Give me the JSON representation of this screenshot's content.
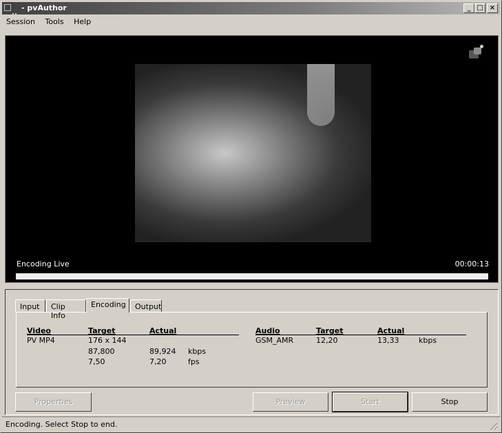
{
  "window": {
    "title": "- pvAuthor",
    "controls": {
      "minimize": "_",
      "maximize": "□",
      "close": "×"
    }
  },
  "menu": [
    "Session",
    "Tools",
    "Help"
  ],
  "video": {
    "status": "Encoding Live",
    "timecode": "00:00:13",
    "progress_percent": 100
  },
  "tabs": [
    {
      "label": "Input",
      "active": false
    },
    {
      "label": "Clip Info",
      "active": false
    },
    {
      "label": "Encoding",
      "active": true
    },
    {
      "label": "Output",
      "active": false
    }
  ],
  "encoding": {
    "video": {
      "headers": [
        "Video",
        "Target",
        "Actual"
      ],
      "codec": "PV MP4",
      "rows": [
        {
          "target": "176 x 144",
          "actual": "",
          "unit": ""
        },
        {
          "target": "87,800",
          "actual": "89,924",
          "unit": "kbps"
        },
        {
          "target": "7,50",
          "actual": "7,20",
          "unit": "fps"
        }
      ]
    },
    "audio": {
      "headers": [
        "Audio",
        "Target",
        "Actual"
      ],
      "codec": "GSM_AMR",
      "rows": [
        {
          "target": "12,20",
          "actual": "13,33",
          "unit": "kbps"
        }
      ]
    }
  },
  "buttons": {
    "properties": "Properties",
    "preview": "Preview",
    "start": "Start",
    "stop": "Stop"
  },
  "status_bar": "Encoding.  Select Stop to end."
}
